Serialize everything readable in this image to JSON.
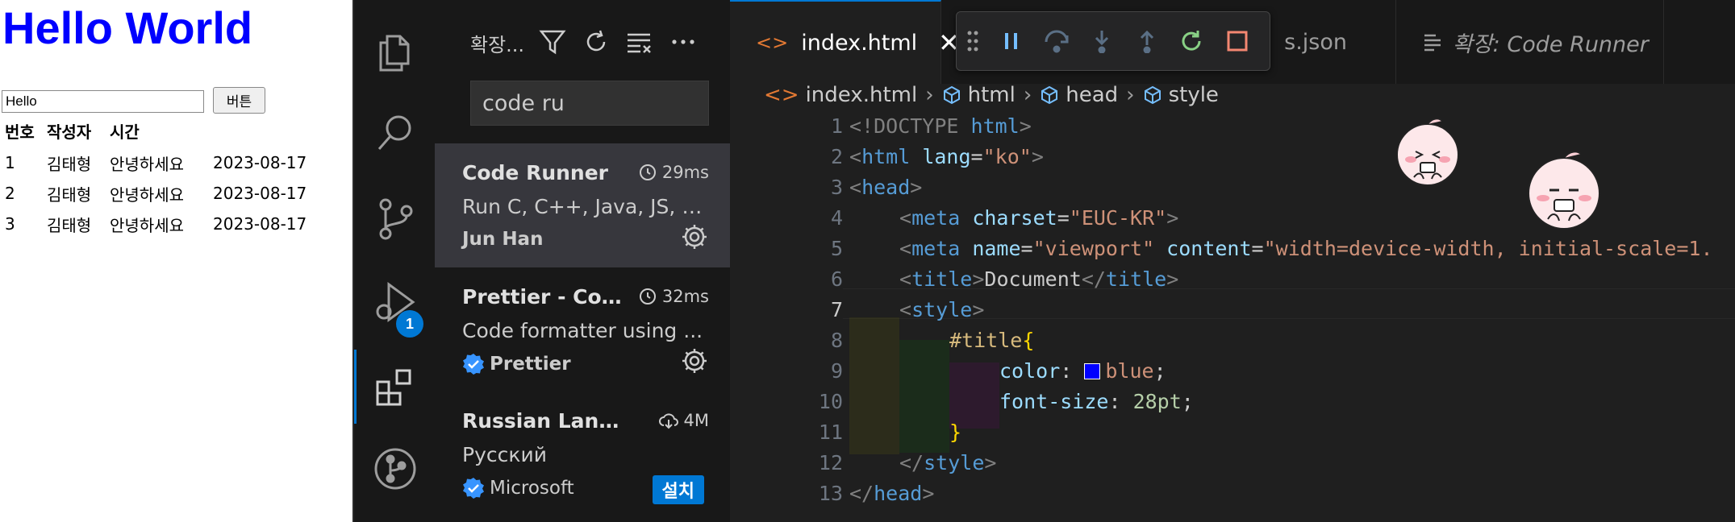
{
  "preview": {
    "heading": "Hello World",
    "input_value": "Hello",
    "button_label": "버튼",
    "table": {
      "headers": [
        "번호",
        "작성자",
        "시간"
      ],
      "rows": [
        [
          "1",
          "김태형",
          "안녕하세요",
          "2023-08-17"
        ],
        [
          "2",
          "김태형",
          "안녕하세요",
          "2023-08-17"
        ],
        [
          "3",
          "김태형",
          "안녕하세요",
          "2023-08-17"
        ]
      ]
    }
  },
  "activity_bar": {
    "items": [
      "explorer-icon",
      "search-icon",
      "source-control-icon",
      "run-debug-icon",
      "extensions-icon",
      "git-graph-icon"
    ],
    "debug_badge": "1"
  },
  "sidebar": {
    "title": "확장...",
    "search_value": "code ru",
    "extensions": [
      {
        "name": "Code Runner",
        "time": "29ms",
        "description": "Run C, C++, Java, JS, P...",
        "publisher": "Jun Han",
        "verified": false,
        "action": "gear"
      },
      {
        "name": "Prettier - Cod...",
        "time": "32ms",
        "description": "Code formatter using ...",
        "publisher": "Prettier",
        "verified": true,
        "action": "gear"
      },
      {
        "name": "Russian Langu...",
        "downloads": "4M",
        "description": "Русский",
        "publisher": "Microsoft",
        "verified": true,
        "action": "설치"
      }
    ]
  },
  "tabs": [
    {
      "label": "index.html",
      "active": true
    },
    {
      "label": "s.json",
      "active": false
    },
    {
      "label": "확장: Code Runner",
      "active": false,
      "italic": true
    }
  ],
  "breadcrumb": [
    "index.html",
    "html",
    "head",
    "style"
  ],
  "code": {
    "current_line": 7,
    "line_numbers": [
      "1",
      "2",
      "3",
      "4",
      "5",
      "6",
      "7",
      "8",
      "9",
      "10",
      "11",
      "12",
      "13"
    ],
    "tokens": {
      "l1_a": "<!DOCTYPE ",
      "l1_b": "html",
      "l1_c": ">",
      "l2_a": "<",
      "l2_b": "html",
      "l2_c": " lang",
      "l2_d": "=",
      "l2_e": "\"ko\"",
      "l2_f": ">",
      "l3_a": "<",
      "l3_b": "head",
      "l3_c": ">",
      "l4_a": "<",
      "l4_b": "meta",
      "l4_c": " charset",
      "l4_d": "=",
      "l4_e": "\"EUC-KR\"",
      "l4_f": ">",
      "l5_a": "<",
      "l5_b": "meta",
      "l5_c": " name",
      "l5_d": "=",
      "l5_e": "\"viewport\"",
      "l5_f": " content",
      "l5_g": "=",
      "l5_h": "\"width=device-width, initial-scale=1.",
      "l6_a": "<",
      "l6_b": "title",
      "l6_c": ">",
      "l6_d": "Document",
      "l6_e": "</",
      "l6_f": "title",
      "l6_g": ">",
      "l7_a": "<",
      "l7_b": "style",
      "l7_c": ">",
      "l8_a": "#title",
      "l8_b": "{",
      "l9_a": "color",
      "l9_b": ": ",
      "l9_c": "blue",
      "l9_d": ";",
      "l10_a": "font-size",
      "l10_b": ": ",
      "l10_c": "28pt",
      "l10_d": ";",
      "l11_a": "}",
      "l12_a": "</",
      "l12_b": "style",
      "l12_c": ">",
      "l13_a": "</",
      "l13_b": "head",
      "l13_c": ">"
    }
  },
  "colors": {
    "accent": "#0078d4",
    "swatch_blue": "#0000ff",
    "heading_blue": "#0000ff"
  }
}
